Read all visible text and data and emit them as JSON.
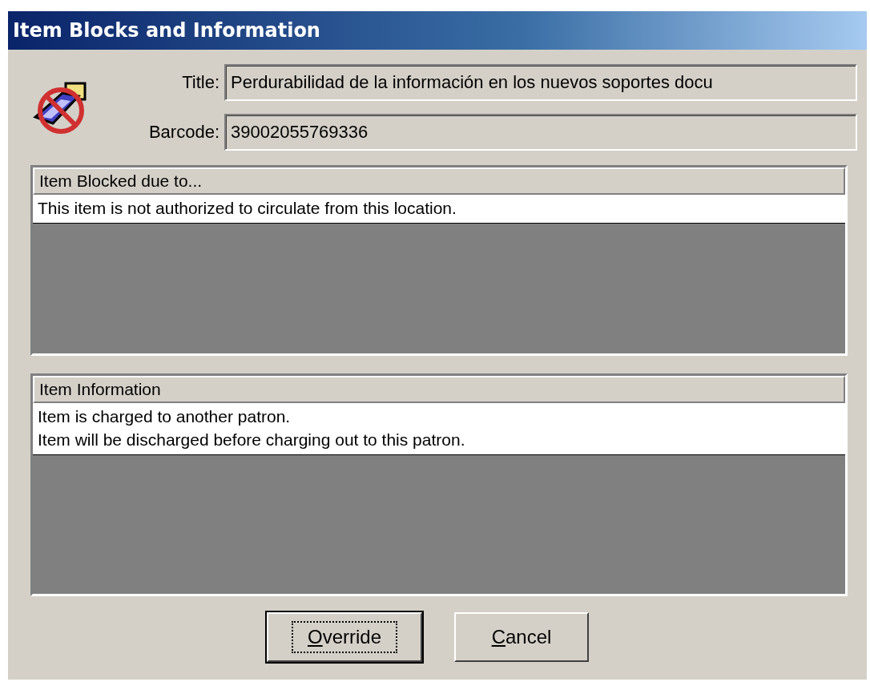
{
  "window": {
    "title": "Item Blocks and Information"
  },
  "fields": [
    {
      "label": "Title:",
      "value": "Perdurabilidad de la información en los nuevos soportes docu"
    },
    {
      "label": "Barcode:",
      "value": "39002055769336"
    }
  ],
  "panels": [
    {
      "header": "Item Blocked due to...",
      "rows": [
        "This item is not authorized to circulate from this location."
      ]
    },
    {
      "header": "Item Information",
      "rows": [
        "Item is charged to another patron.",
        "Item will be discharged before charging out to this patron."
      ]
    }
  ],
  "buttons": [
    {
      "mnemonic": "O",
      "rest": "verride",
      "default": true
    },
    {
      "mnemonic": "C",
      "rest": "ancel",
      "default": false
    }
  ]
}
